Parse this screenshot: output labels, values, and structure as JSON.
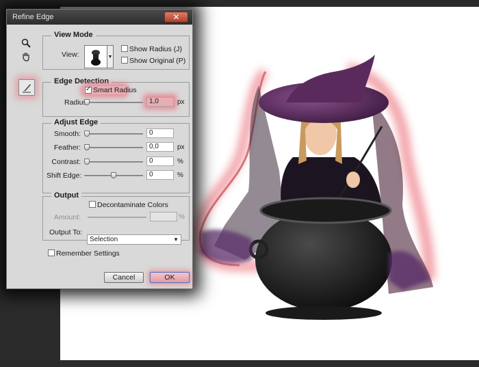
{
  "dialog": {
    "title": "Refine Edge",
    "close_label": "✕"
  },
  "tools": {
    "zoom": "zoom-icon",
    "hand": "hand-icon",
    "refine_radius": "refine-radius-brush-icon"
  },
  "view_mode": {
    "title": "View Mode",
    "view_label": "View:",
    "show_radius_label": "Show Radius (J)",
    "show_radius_checked": false,
    "show_original_label": "Show Original (P)",
    "show_original_checked": false
  },
  "edge_detection": {
    "title": "Edge Detection",
    "smart_radius_label": "Smart Radius",
    "smart_radius_checked": true,
    "radius_label": "Radius:",
    "radius_value": "1,0",
    "radius_unit": "px",
    "radius_fraction": 0.0
  },
  "adjust_edge": {
    "title": "Adjust Edge",
    "smooth_label": "Smooth:",
    "smooth_value": "0",
    "smooth_fraction": 0.0,
    "feather_label": "Feather:",
    "feather_value": "0,0",
    "feather_unit": "px",
    "feather_fraction": 0.0,
    "contrast_label": "Contrast:",
    "contrast_value": "0",
    "contrast_unit": "%",
    "contrast_fraction": 0.0,
    "shift_edge_label": "Shift Edge:",
    "shift_edge_value": "0",
    "shift_edge_unit": "%",
    "shift_edge_fraction": 0.5
  },
  "output": {
    "title": "Output",
    "decontaminate_label": "Decontaminate Colors",
    "decontaminate_checked": false,
    "amount_label": "Amount:",
    "amount_unit": "%",
    "output_to_label": "Output To:",
    "output_to_value": "Selection"
  },
  "footer": {
    "remember_label": "Remember Settings",
    "remember_checked": false,
    "cancel_label": "Cancel",
    "ok_label": "OK"
  },
  "colors": {
    "highlight": "#eb6e7d",
    "dialog_bg": "#d9d9d9",
    "canvas_bg": "#ffffff",
    "workspace_bg": "#2b2b2b"
  }
}
